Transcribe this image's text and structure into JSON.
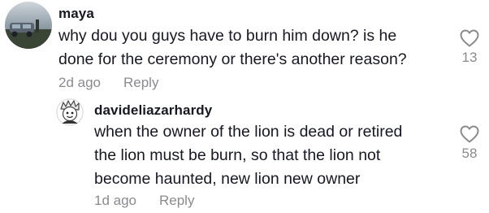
{
  "comments": [
    {
      "username": "maya",
      "text": "why dou you guys have to burn him down? is he\ndone for the ceremony or there's another reason?",
      "time": "2d ago",
      "reply_label": "Reply",
      "likes": "13",
      "like_icon": "heart-outline-icon"
    },
    {
      "username": "davideliazarhardy",
      "text": "when the owner of the lion is dead or retired\nthe lion must be burn, so that the lion not\nbecome haunted, new lion new owner",
      "time": "1d ago",
      "reply_label": "Reply",
      "likes": "58",
      "like_icon": "heart-outline-icon"
    }
  ]
}
